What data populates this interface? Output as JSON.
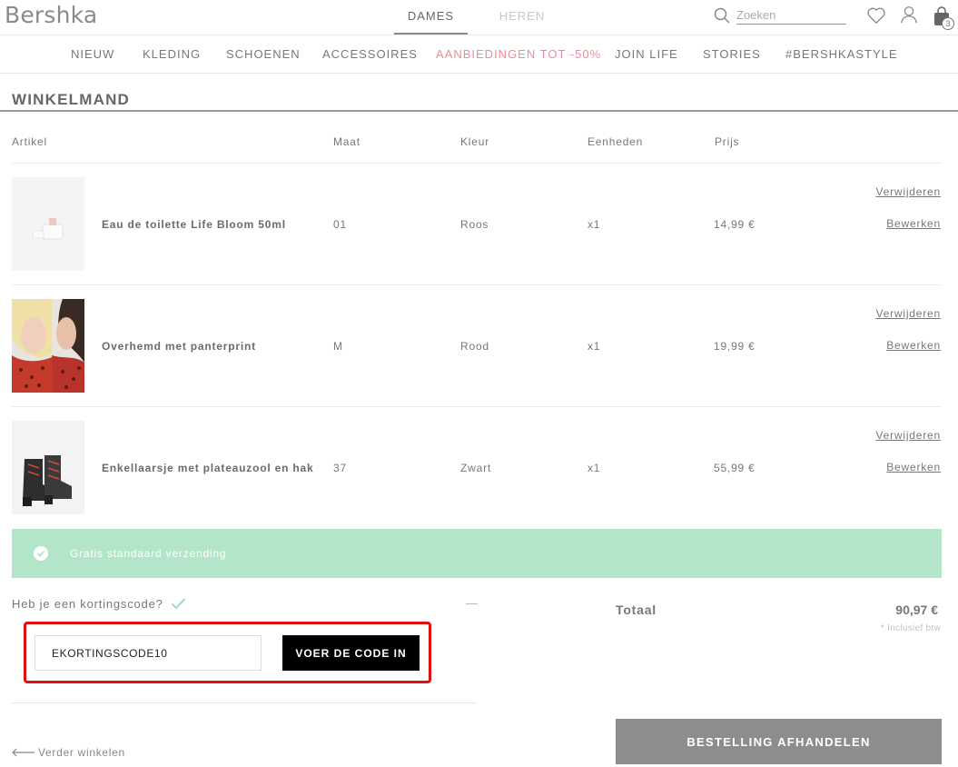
{
  "brand": {
    "name": "Bershka"
  },
  "gender_tabs": [
    {
      "label": "DAMES",
      "active": true
    },
    {
      "label": "HEREN",
      "active": false
    }
  ],
  "search": {
    "placeholder": "Zoeken"
  },
  "bag": {
    "count": "3"
  },
  "nav": [
    {
      "label": "NIEUW"
    },
    {
      "label": "KLEDING"
    },
    {
      "label": "SCHOENEN"
    },
    {
      "label": "ACCESSOIRES"
    },
    {
      "label": "AANBIEDINGEN TOT -50%"
    },
    {
      "label": "JOIN LIFE"
    },
    {
      "label": "STORIES"
    },
    {
      "label": "#BERSHKASTYLE"
    }
  ],
  "cart": {
    "title": "WINKELMAND",
    "columns": {
      "article": "Artikel",
      "size": "Maat",
      "color": "Kleur",
      "units": "Eenheden",
      "price": "Prijs"
    },
    "remove_label": "Verwijderen",
    "edit_label": "Bewerken",
    "items": [
      {
        "name": "Eau de toilette Life Bloom 50ml",
        "size": "01",
        "color": "Roos",
        "qty": "x1",
        "price": "14,99 €"
      },
      {
        "name": "Overhemd met panterprint",
        "size": "M",
        "color": "Rood",
        "qty": "x1",
        "price": "19,99 €"
      },
      {
        "name": "Enkellaarsje met plateauzool en hak",
        "size": "37",
        "color": "Zwart",
        "qty": "x1",
        "price": "55,99 €"
      }
    ]
  },
  "shipping": {
    "text": "Gratis standaard verzending"
  },
  "coupon": {
    "question": "Heb je een kortingscode?",
    "value": "EKORTINGSCODE10",
    "button_label": "VOER DE CODE IN"
  },
  "summary": {
    "total_label": "Totaal",
    "total_value": "90,97 €",
    "vat_note": "* Inclusief btw"
  },
  "actions": {
    "continue_label": "Verder winkelen",
    "checkout_label": "BESTELLING AFHANDELEN"
  },
  "colors": {
    "shipping_banner": "#b3e6c8",
    "sale_link": "#f08a9a",
    "highlight_box": "#e01010",
    "checkout_button": "#8d8d8d"
  }
}
